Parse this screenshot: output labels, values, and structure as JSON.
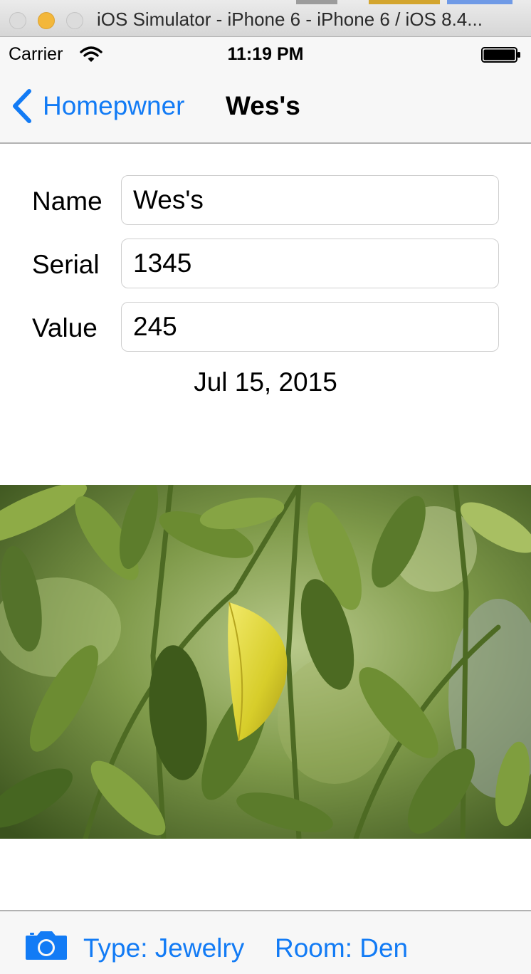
{
  "window": {
    "title": "iOS Simulator - iPhone 6 - iPhone 6 / iOS 8.4..."
  },
  "status_bar": {
    "carrier": "Carrier",
    "time": "11:19 PM",
    "icons": [
      "wifi-icon",
      "battery-icon"
    ]
  },
  "nav_bar": {
    "back_label": "Homepwner",
    "title": "Wes's"
  },
  "form": {
    "name_label": "Name",
    "name_value": "Wes's",
    "serial_label": "Serial",
    "serial_value": "1345",
    "value_label": "Value",
    "value_value": "245",
    "date_created": "Jul 15, 2015"
  },
  "photo": {
    "icon": "leaf-photo"
  },
  "toolbar": {
    "camera_icon": "camera-icon",
    "type_label": "Type: Jewelry",
    "room_label": "Room: Den"
  },
  "colors": {
    "ios_blue": "#127bf5",
    "bar_background": "#f7f7f7"
  }
}
